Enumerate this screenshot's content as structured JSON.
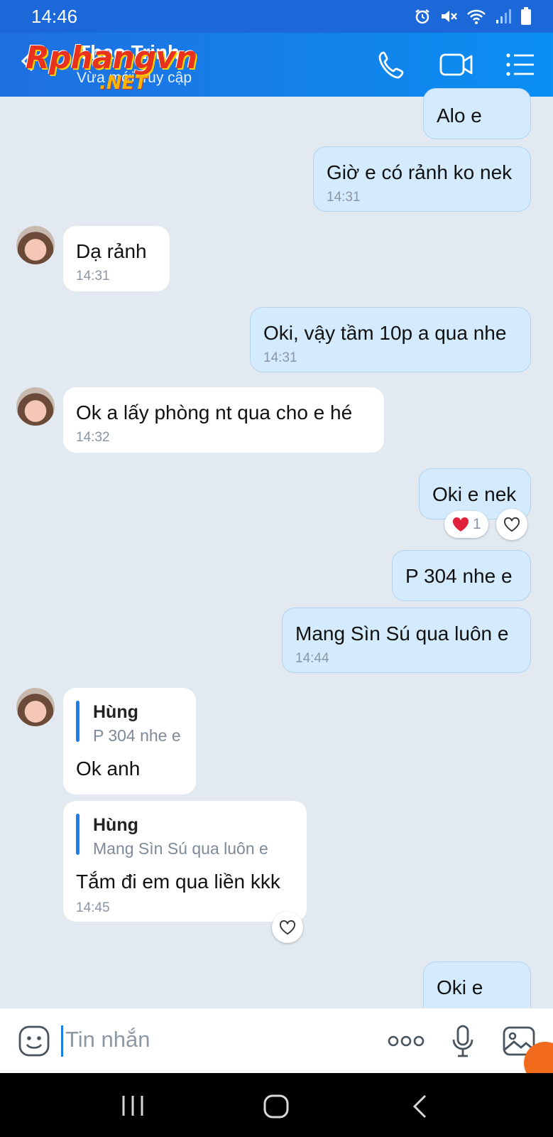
{
  "status_bar": {
    "time": "14:46"
  },
  "header": {
    "contact_name": "Thao Trinh",
    "contact_status": "Vừa mới truy cập",
    "watermark": "Rphangvn",
    "watermark_sub": ".NET"
  },
  "messages": [
    {
      "direction": "out",
      "text": "Alo e",
      "time": ""
    },
    {
      "direction": "out",
      "text": "Giờ e có rảnh ko nek",
      "time": "14:31"
    },
    {
      "direction": "in",
      "text": "Dạ rảnh",
      "time": "14:31"
    },
    {
      "direction": "out",
      "text": "Oki, vậy tầm 10p a qua nhe",
      "time": "14:31"
    },
    {
      "direction": "in",
      "text": "Ok a lấy phòng nt qua cho e hé",
      "time": "14:32"
    },
    {
      "direction": "out",
      "text": "Oki e nek",
      "time": "",
      "reaction_count": "1"
    },
    {
      "direction": "out",
      "text": "P 304 nhe e",
      "time": ""
    },
    {
      "direction": "out",
      "text": "Mang Sìn Sú qua luôn e",
      "time": "14:44"
    },
    {
      "direction": "in",
      "quote_name": "Hùng",
      "quote_text": "P 304 nhe e",
      "text": "Ok anh",
      "time": ""
    },
    {
      "direction": "in",
      "quote_name": "Hùng",
      "quote_text": "Mang Sìn Sú qua luôn e",
      "text": "Tắm đi em qua liền kkk",
      "time": "14:45"
    },
    {
      "direction": "out",
      "text": "Oki e",
      "time": ""
    }
  ],
  "input": {
    "placeholder": "Tin nhắn"
  },
  "icons": {
    "back": "back-arrow-icon",
    "call": "phone-icon",
    "video": "video-call-icon",
    "menu": "menu-list-icon",
    "emoji": "emoji-icon",
    "more": "more-dots-icon",
    "mic": "microphone-icon",
    "image": "image-icon",
    "heart": "heart-icon",
    "nav_recent": "recent-apps-icon",
    "nav_home": "home-icon",
    "nav_back": "nav-back-icon"
  },
  "colors": {
    "header": "#1c68d8",
    "outgoing_bubble": "#d3ebfd",
    "incoming_bubble": "#ffffff",
    "background": "#e2e9f1",
    "accent": "#1c7ee8",
    "reaction": "#e0213a"
  }
}
